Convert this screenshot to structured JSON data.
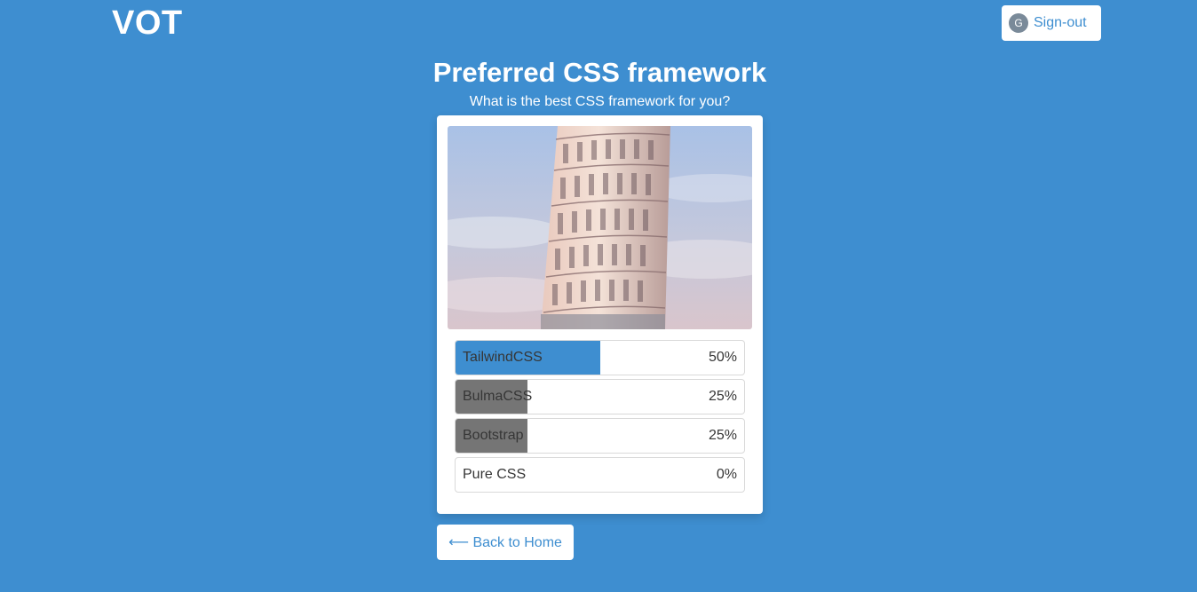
{
  "brand": "VOT",
  "header": {
    "avatar_initial": "G",
    "signout_label": "Sign-out"
  },
  "poll": {
    "title": "Preferred CSS framework",
    "subtitle": "What is the best CSS framework for you?",
    "image_icon": "leaning-tower-photo",
    "options": [
      {
        "label": "TailwindCSS",
        "percent_text": "50%",
        "fraction": 0.5,
        "fill_color": "#3e8ed0"
      },
      {
        "label": "BulmaCSS",
        "percent_text": "25%",
        "fraction": 0.25,
        "fill_color": "#757575"
      },
      {
        "label": "Bootstrap",
        "percent_text": "25%",
        "fraction": 0.25,
        "fill_color": "#757575"
      },
      {
        "label": "Pure CSS",
        "percent_text": "0%",
        "fraction": 0,
        "fill_color": "#757575"
      }
    ]
  },
  "back": {
    "label": "⟵ Back to Home"
  },
  "colors": {
    "background": "#3e8ed0",
    "accent": "#3e8ed0",
    "muted_fill": "#757575"
  }
}
